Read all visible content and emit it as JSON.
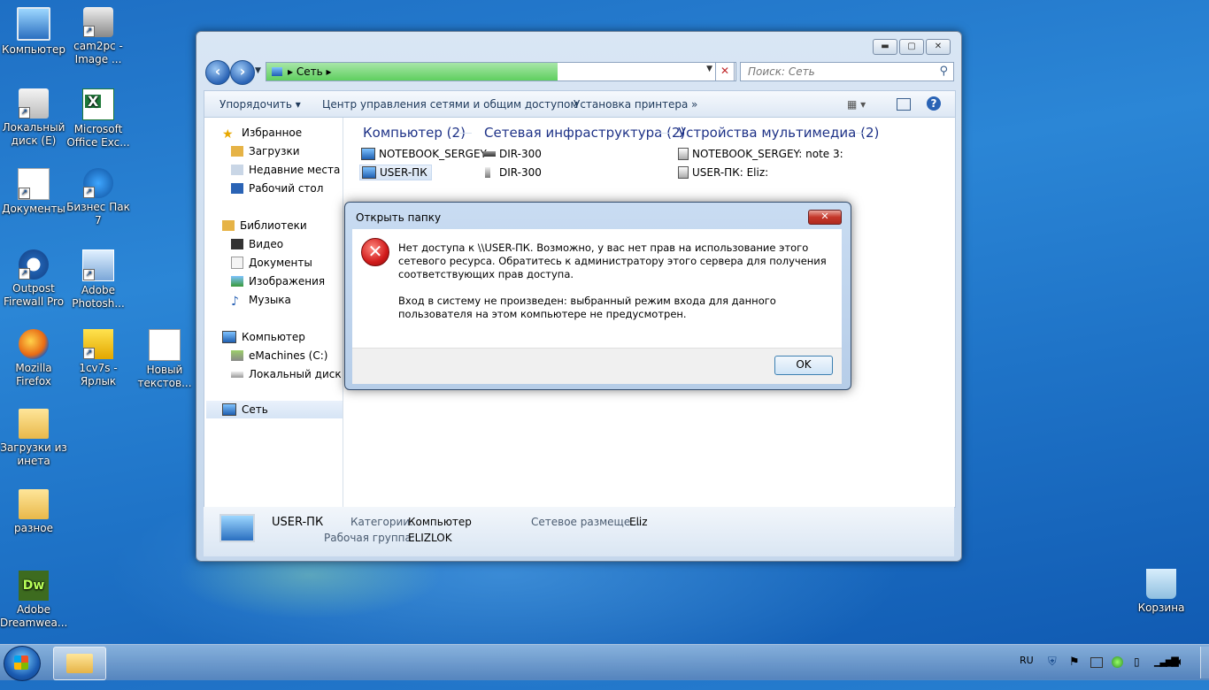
{
  "desktop": {
    "icons": [
      {
        "label": "Компьютер"
      },
      {
        "label": "cam2pc - Image ..."
      },
      {
        "label": "Локальный диск (E)"
      },
      {
        "label": "Microsoft Office Exc..."
      },
      {
        "label": "Документы"
      },
      {
        "label": "Бизнес Пак 7"
      },
      {
        "label": "Outpost Firewall Pro"
      },
      {
        "label": "Adobe Photosh..."
      },
      {
        "label": "Mozilla Firefox"
      },
      {
        "label": "1cv7s - Ярлык"
      },
      {
        "label": "Новый текстов..."
      },
      {
        "label": "Загрузки из инета"
      },
      {
        "label": "разное"
      },
      {
        "label": "Adobe Dreamwea..."
      },
      {
        "label": "Корзина"
      }
    ]
  },
  "explorer": {
    "title_buttons": {
      "minimize": "▬",
      "maximize": "▢",
      "close": "✕"
    },
    "address": {
      "path": "Сеть",
      "progress": 0.62
    },
    "search_placeholder": "Поиск: Сеть",
    "toolbar": {
      "organize": "Упорядочить",
      "network_center": "Центр управления сетями и общим доступом",
      "add_printer": "Установка принтера",
      "more": "»"
    },
    "nav": {
      "favorites": "Избранное",
      "downloads": "Загрузки",
      "recent": "Недавние места",
      "desktop": "Рабочий стол",
      "libraries": "Библиотеки",
      "video": "Видео",
      "documents": "Документы",
      "images": "Изображения",
      "music": "Музыка",
      "computer": "Компьютер",
      "drive_c": "eMachines (C:)",
      "drive_e": "Локальный диск (E:",
      "network": "Сеть"
    },
    "groups": [
      {
        "header": "Компьютер (2)",
        "items": [
          "NOTEBOOK_SERGEY",
          "USER-ПК"
        ]
      },
      {
        "header": "Сетевая инфраструктура (2)",
        "items": [
          "DIR-300",
          "DIR-300"
        ]
      },
      {
        "header": "Устройства мультимедиа (2)",
        "items": [
          "NOTEBOOK_SERGEY: note 3:",
          "USER-ПК: Eliz:"
        ]
      }
    ],
    "details": {
      "name": "USER-ПК",
      "categories_label": "Категории:",
      "categories_value": "Компьютер",
      "workgroup_label": "Рабочая группа:",
      "workgroup_value": "ELIZLOK",
      "location_label": "Сетевое размеще...",
      "location_value": "Eliz"
    }
  },
  "dialog": {
    "title": "Открыть папку",
    "close": "✕",
    "message1": "Нет доступа к \\\\USER-ПК. Возможно, у вас нет прав на использование этого сетевого ресурса. Обратитесь к администратору этого сервера для получения соответствующих прав доступа.",
    "message2": "Вход в систему не произведен: выбранный режим входа для данного пользователя на этом компьютере не предусмотрен.",
    "ok": "OK"
  },
  "taskbar": {
    "lang": "RU"
  }
}
